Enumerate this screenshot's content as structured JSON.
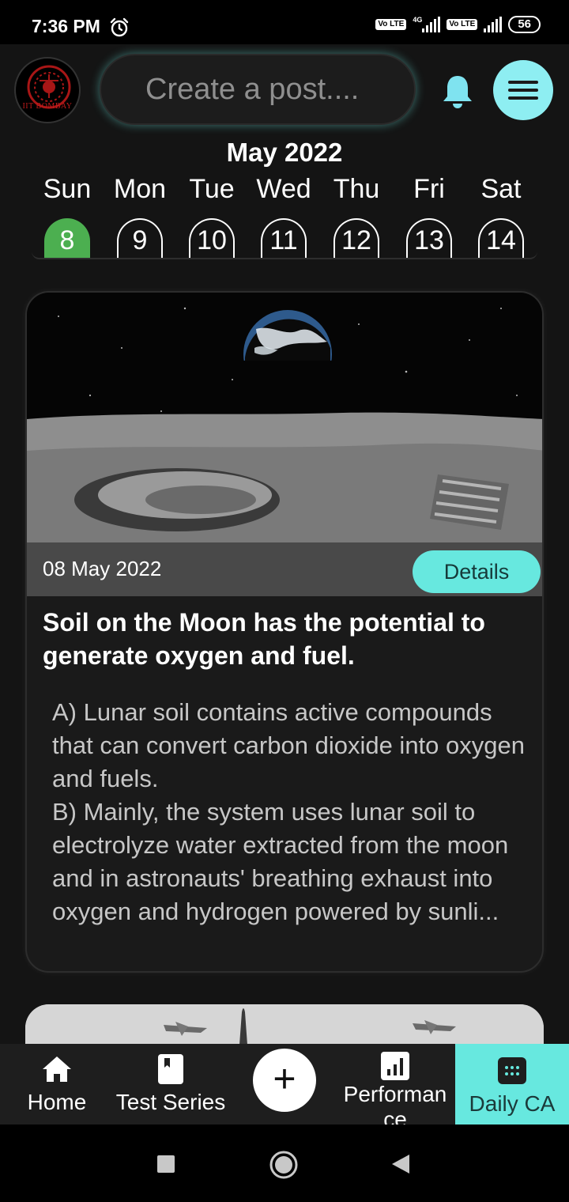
{
  "status_bar": {
    "time": "7:36 PM",
    "network": "4G",
    "volte": "Vo LTE",
    "battery": "56"
  },
  "header": {
    "logo_text": "IIT BOMBAY",
    "post_placeholder": "Create a post...."
  },
  "calendar": {
    "month": "May 2022",
    "days": [
      {
        "name": "Sun",
        "num": "8"
      },
      {
        "name": "Mon",
        "num": "9"
      },
      {
        "name": "Tue",
        "num": "10"
      },
      {
        "name": "Wed",
        "num": "11"
      },
      {
        "name": "Thu",
        "num": "12"
      },
      {
        "name": "Fri",
        "num": "13"
      },
      {
        "name": "Sat",
        "num": "14"
      }
    ]
  },
  "card": {
    "date": "08 May 2022",
    "details_label": "Details",
    "title": "Soil on the Moon has the potential to generate oxygen and fuel.",
    "body": "A) Lunar soil contains active compounds that can convert carbon dioxide into oxygen and fuels.\nB) Mainly, the system uses lunar soil to electrolyze water extracted from the moon and in astronauts' breathing exhaust into oxygen and hydrogen powered by sunli..."
  },
  "bottom_nav": {
    "home": "Home",
    "test_series": "Test Series",
    "add": "+",
    "performance": "Performance",
    "daily_ca": "Daily CA"
  },
  "colors": {
    "accent": "#67e8df",
    "today": "#4caf50",
    "menu_button": "#8eeef2"
  }
}
